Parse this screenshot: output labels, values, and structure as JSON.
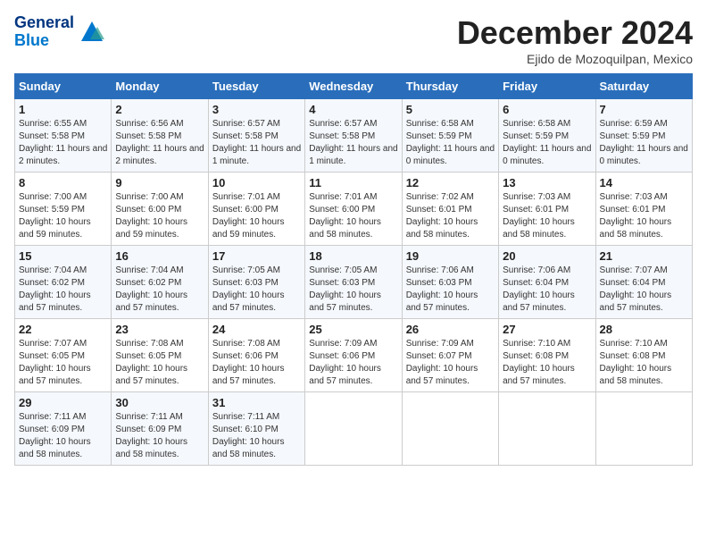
{
  "header": {
    "logo_line1": "General",
    "logo_line2": "Blue",
    "month_title": "December 2024",
    "location": "Ejido de Mozoquilpan, Mexico"
  },
  "weekdays": [
    "Sunday",
    "Monday",
    "Tuesday",
    "Wednesday",
    "Thursday",
    "Friday",
    "Saturday"
  ],
  "weeks": [
    [
      {
        "day": "1",
        "info": "Sunrise: 6:55 AM\nSunset: 5:58 PM\nDaylight: 11 hours and 2 minutes."
      },
      {
        "day": "2",
        "info": "Sunrise: 6:56 AM\nSunset: 5:58 PM\nDaylight: 11 hours and 2 minutes."
      },
      {
        "day": "3",
        "info": "Sunrise: 6:57 AM\nSunset: 5:58 PM\nDaylight: 11 hours and 1 minute."
      },
      {
        "day": "4",
        "info": "Sunrise: 6:57 AM\nSunset: 5:58 PM\nDaylight: 11 hours and 1 minute."
      },
      {
        "day": "5",
        "info": "Sunrise: 6:58 AM\nSunset: 5:59 PM\nDaylight: 11 hours and 0 minutes."
      },
      {
        "day": "6",
        "info": "Sunrise: 6:58 AM\nSunset: 5:59 PM\nDaylight: 11 hours and 0 minutes."
      },
      {
        "day": "7",
        "info": "Sunrise: 6:59 AM\nSunset: 5:59 PM\nDaylight: 11 hours and 0 minutes."
      }
    ],
    [
      {
        "day": "8",
        "info": "Sunrise: 7:00 AM\nSunset: 5:59 PM\nDaylight: 10 hours and 59 minutes."
      },
      {
        "day": "9",
        "info": "Sunrise: 7:00 AM\nSunset: 6:00 PM\nDaylight: 10 hours and 59 minutes."
      },
      {
        "day": "10",
        "info": "Sunrise: 7:01 AM\nSunset: 6:00 PM\nDaylight: 10 hours and 59 minutes."
      },
      {
        "day": "11",
        "info": "Sunrise: 7:01 AM\nSunset: 6:00 PM\nDaylight: 10 hours and 58 minutes."
      },
      {
        "day": "12",
        "info": "Sunrise: 7:02 AM\nSunset: 6:01 PM\nDaylight: 10 hours and 58 minutes."
      },
      {
        "day": "13",
        "info": "Sunrise: 7:03 AM\nSunset: 6:01 PM\nDaylight: 10 hours and 58 minutes."
      },
      {
        "day": "14",
        "info": "Sunrise: 7:03 AM\nSunset: 6:01 PM\nDaylight: 10 hours and 58 minutes."
      }
    ],
    [
      {
        "day": "15",
        "info": "Sunrise: 7:04 AM\nSunset: 6:02 PM\nDaylight: 10 hours and 57 minutes."
      },
      {
        "day": "16",
        "info": "Sunrise: 7:04 AM\nSunset: 6:02 PM\nDaylight: 10 hours and 57 minutes."
      },
      {
        "day": "17",
        "info": "Sunrise: 7:05 AM\nSunset: 6:03 PM\nDaylight: 10 hours and 57 minutes."
      },
      {
        "day": "18",
        "info": "Sunrise: 7:05 AM\nSunset: 6:03 PM\nDaylight: 10 hours and 57 minutes."
      },
      {
        "day": "19",
        "info": "Sunrise: 7:06 AM\nSunset: 6:03 PM\nDaylight: 10 hours and 57 minutes."
      },
      {
        "day": "20",
        "info": "Sunrise: 7:06 AM\nSunset: 6:04 PM\nDaylight: 10 hours and 57 minutes."
      },
      {
        "day": "21",
        "info": "Sunrise: 7:07 AM\nSunset: 6:04 PM\nDaylight: 10 hours and 57 minutes."
      }
    ],
    [
      {
        "day": "22",
        "info": "Sunrise: 7:07 AM\nSunset: 6:05 PM\nDaylight: 10 hours and 57 minutes."
      },
      {
        "day": "23",
        "info": "Sunrise: 7:08 AM\nSunset: 6:05 PM\nDaylight: 10 hours and 57 minutes."
      },
      {
        "day": "24",
        "info": "Sunrise: 7:08 AM\nSunset: 6:06 PM\nDaylight: 10 hours and 57 minutes."
      },
      {
        "day": "25",
        "info": "Sunrise: 7:09 AM\nSunset: 6:06 PM\nDaylight: 10 hours and 57 minutes."
      },
      {
        "day": "26",
        "info": "Sunrise: 7:09 AM\nSunset: 6:07 PM\nDaylight: 10 hours and 57 minutes."
      },
      {
        "day": "27",
        "info": "Sunrise: 7:10 AM\nSunset: 6:08 PM\nDaylight: 10 hours and 57 minutes."
      },
      {
        "day": "28",
        "info": "Sunrise: 7:10 AM\nSunset: 6:08 PM\nDaylight: 10 hours and 58 minutes."
      }
    ],
    [
      {
        "day": "29",
        "info": "Sunrise: 7:11 AM\nSunset: 6:09 PM\nDaylight: 10 hours and 58 minutes."
      },
      {
        "day": "30",
        "info": "Sunrise: 7:11 AM\nSunset: 6:09 PM\nDaylight: 10 hours and 58 minutes."
      },
      {
        "day": "31",
        "info": "Sunrise: 7:11 AM\nSunset: 6:10 PM\nDaylight: 10 hours and 58 minutes."
      },
      null,
      null,
      null,
      null
    ]
  ]
}
